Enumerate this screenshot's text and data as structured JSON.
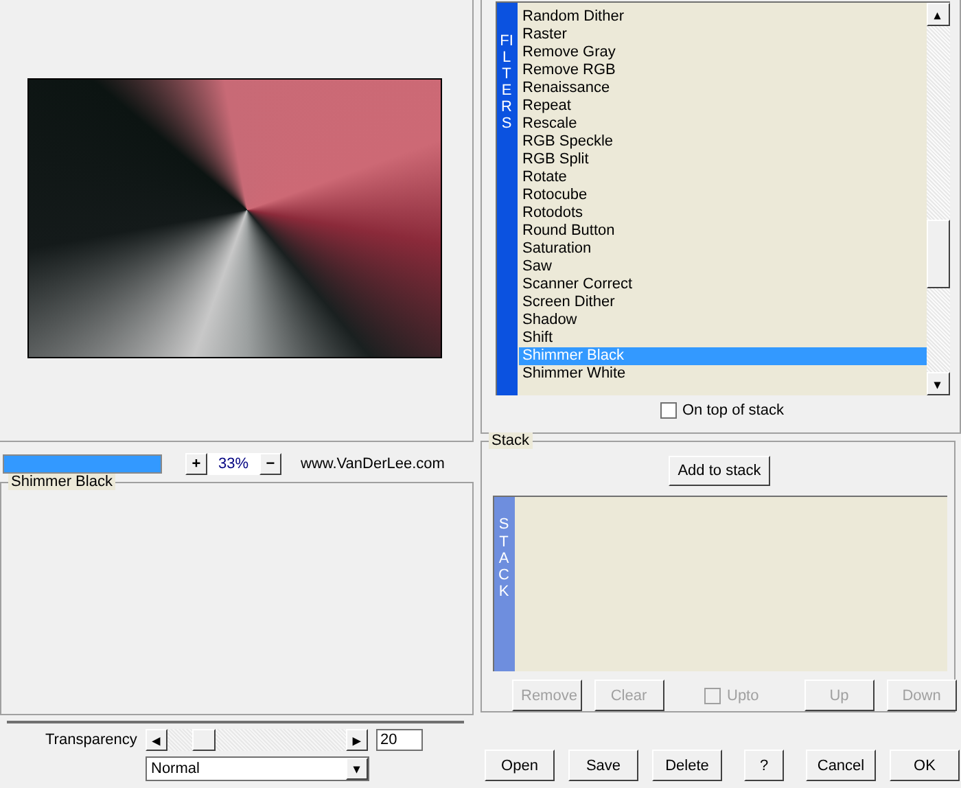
{
  "zoom": {
    "progress": {
      "level": 1
    },
    "zoom_in": "+",
    "value": "33%",
    "zoom_out": "−",
    "link": "www.VanDerLee.com"
  },
  "settings": {
    "title": "Shimmer Black",
    "transparency": {
      "label": "Transparency",
      "left": "◂",
      "right": "▸",
      "level": 0.2,
      "value": "20"
    },
    "blend_mode": {
      "value": "Normal",
      "arrow": "▾"
    }
  },
  "filters": {
    "strip_label": "FILTERS",
    "items": [
      {
        "label": "Random Dither",
        "selected": false
      },
      {
        "label": "Raster",
        "selected": false
      },
      {
        "label": "Remove Gray",
        "selected": false
      },
      {
        "label": "Remove RGB",
        "selected": false
      },
      {
        "label": "Renaissance",
        "selected": false
      },
      {
        "label": "Repeat",
        "selected": false
      },
      {
        "label": "Rescale",
        "selected": false
      },
      {
        "label": "RGB Speckle",
        "selected": false
      },
      {
        "label": "RGB Split",
        "selected": false
      },
      {
        "label": "Rotate",
        "selected": false
      },
      {
        "label": "Rotocube",
        "selected": false
      },
      {
        "label": "Rotodots",
        "selected": false
      },
      {
        "label": "Round Button",
        "selected": false
      },
      {
        "label": "Saturation",
        "selected": false
      },
      {
        "label": "Saw",
        "selected": false
      },
      {
        "label": "Scanner Correct",
        "selected": false
      },
      {
        "label": "Screen Dither",
        "selected": false
      },
      {
        "label": "Shadow",
        "selected": false
      },
      {
        "label": "Shift",
        "selected": false
      },
      {
        "label": "Shimmer Black",
        "selected": true
      },
      {
        "label": "Shimmer White",
        "selected": false
      }
    ],
    "scroll_up": "▴",
    "scroll_down": "▾",
    "on_top": {
      "label": "On top of stack",
      "checked": false
    }
  },
  "stack": {
    "title": "Stack",
    "add": "Add to stack",
    "strip_label": "STACK",
    "controls": [
      {
        "kind": "button",
        "label": "Remove",
        "disabled": true
      },
      {
        "kind": "button",
        "label": "Clear",
        "disabled": true
      },
      {
        "kind": "checkbox",
        "label": "Upto",
        "checked": false,
        "disabled": true
      },
      {
        "kind": "button",
        "label": "Up",
        "disabled": true
      },
      {
        "kind": "button",
        "label": "Down",
        "disabled": true
      }
    ]
  },
  "buttons": [
    "Open",
    "Save",
    "Delete",
    "?",
    "Cancel",
    "OK"
  ]
}
